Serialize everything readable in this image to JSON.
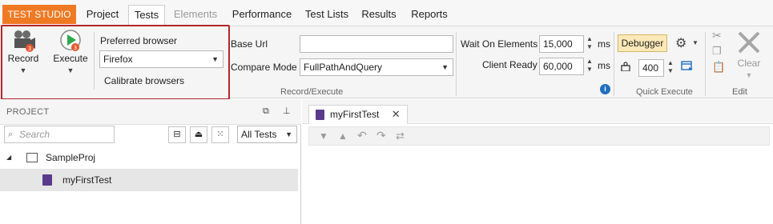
{
  "menubar": {
    "brand": "TEST STUDIO",
    "tabs": [
      {
        "label": "Project"
      },
      {
        "label": "Tests"
      },
      {
        "label": "Elements"
      },
      {
        "label": "Performance"
      },
      {
        "label": "Test Lists"
      },
      {
        "label": "Results"
      },
      {
        "label": "Reports"
      }
    ]
  },
  "ribbon": {
    "record_label": "Record",
    "execute_label": "Execute",
    "preferred_browser_label": "Preferred browser",
    "preferred_browser_value": "Firefox",
    "calibrate_label": "Calibrate browsers",
    "base_url_label": "Base Url",
    "base_url_value": "",
    "compare_mode_label": "Compare Mode",
    "compare_mode_value": "FullPathAndQuery",
    "wait_on_elements_label": "Wait On Elements",
    "wait_on_elements_value": "15,000",
    "client_ready_label": "Client Ready",
    "client_ready_value": "60,000",
    "ms_unit": "ms",
    "group_record_execute": "Record/Execute",
    "debugger_label": "Debugger",
    "quick_execute_value": "400",
    "group_quick_execute": "Quick Execute",
    "clear_label": "Clear",
    "group_edit": "Edit"
  },
  "project_panel": {
    "title": "PROJECT",
    "search_placeholder": "Search",
    "filter_value": "All Tests",
    "tree": [
      {
        "label": "SampleProj"
      },
      {
        "label": "myFirstTest"
      }
    ]
  },
  "editor": {
    "tab_label": "myFirstTest"
  },
  "colors": {
    "brand": "#f07a24",
    "highlight": "#b3262b",
    "debugger_bg": "#fde9b8"
  }
}
